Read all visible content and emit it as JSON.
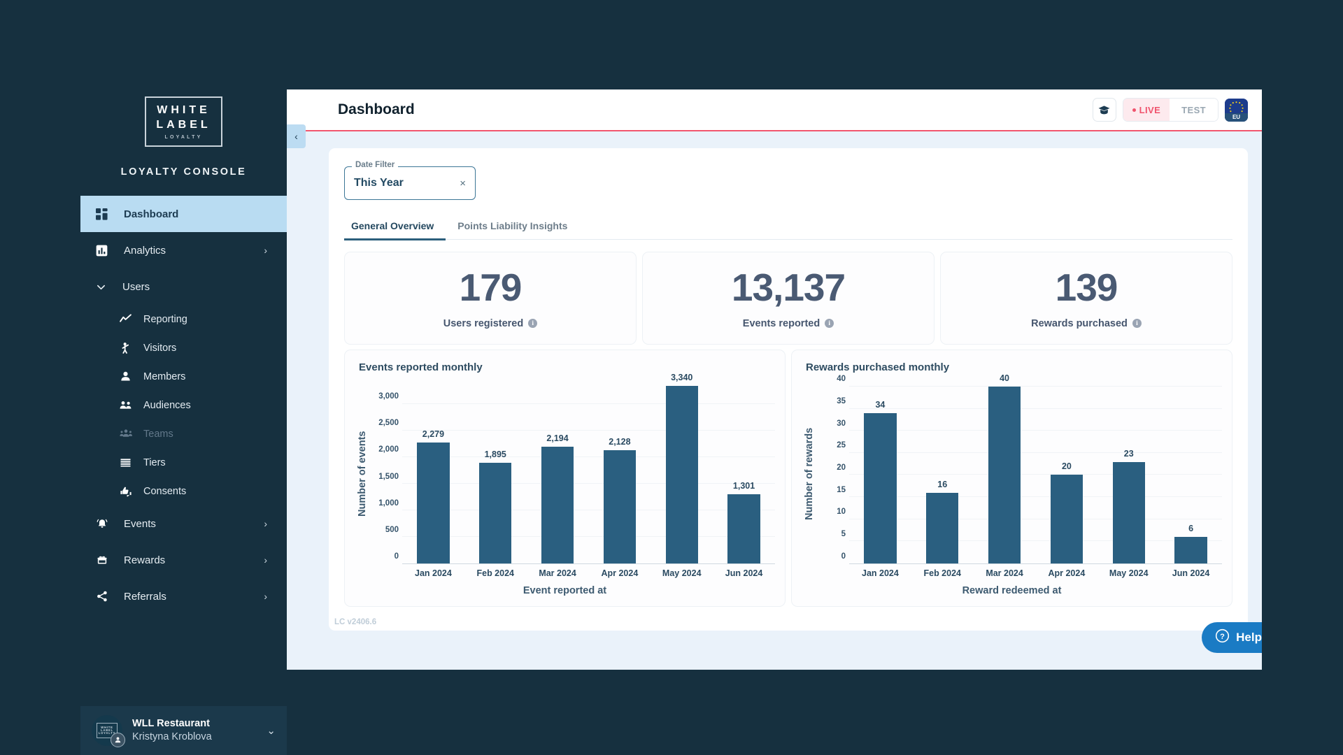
{
  "sidebar": {
    "logo": {
      "line1": "WHITE",
      "line2": "LABEL",
      "line3": "LOYALTY"
    },
    "console_title": "LOYALTY CONSOLE",
    "items": [
      {
        "label": "Dashboard",
        "icon": "dashboard-grid-icon",
        "active": true
      },
      {
        "label": "Analytics",
        "icon": "bar-chart-icon",
        "chevron": "›"
      },
      {
        "label": "Users",
        "icon": "chevron-down-icon",
        "expanded": true
      },
      {
        "label": "Reporting",
        "icon": "line-chart-icon",
        "sub": true
      },
      {
        "label": "Visitors",
        "icon": "visitor-person-icon",
        "sub": true
      },
      {
        "label": "Members",
        "icon": "person-icon",
        "sub": true
      },
      {
        "label": "Audiences",
        "icon": "people-group-icon",
        "sub": true
      },
      {
        "label": "Teams",
        "icon": "teams-icon",
        "sub": true,
        "disabled": true
      },
      {
        "label": "Tiers",
        "icon": "layers-lines-icon",
        "sub": true
      },
      {
        "label": "Consents",
        "icon": "thumbs-up-down-icon",
        "sub": true
      },
      {
        "label": "Events",
        "icon": "bell-icon",
        "chevron": "›"
      },
      {
        "label": "Rewards",
        "icon": "gift-icon",
        "chevron": "›"
      },
      {
        "label": "Referrals",
        "icon": "share-icon",
        "chevron": "›"
      }
    ],
    "profile": {
      "org": "WLL Restaurant",
      "user": "Kristyna Kroblova",
      "chevron": "⌄"
    }
  },
  "collapse_handle": {
    "glyph": "‹"
  },
  "header": {
    "title": "Dashboard",
    "graduation_icon": "graduation-cap-icon",
    "env_live": "LIVE",
    "env_test": "TEST",
    "region_badge": "EU",
    "accent_color": "#f2566e"
  },
  "filters": {
    "date_filter_legend": "Date Filter",
    "date_filter_value": "This Year",
    "clear_glyph": "×"
  },
  "tabs": [
    {
      "label": "General Overview",
      "active": true
    },
    {
      "label": "Points Liability Insights",
      "active": false
    }
  ],
  "kpis": [
    {
      "value": "179",
      "label": "Users registered",
      "info": "i"
    },
    {
      "value": "13,137",
      "label": "Events reported",
      "info": "i"
    },
    {
      "value": "139",
      "label": "Rewards purchased",
      "info": "i"
    }
  ],
  "footer": {
    "version": "LC v2406.6",
    "help_label": "Help",
    "help_icon": "question-circle-icon"
  },
  "chart_data": [
    {
      "type": "bar",
      "title": "Events reported monthly",
      "xlabel": "Event reported at",
      "ylabel": "Number of events",
      "categories": [
        "Jan 2024",
        "Feb 2024",
        "Mar 2024",
        "Apr 2024",
        "May 2024",
        "Jun 2024"
      ],
      "values": [
        2279,
        1895,
        2194,
        2128,
        3340,
        1301
      ],
      "value_labels": [
        "2,279",
        "1,895",
        "2,194",
        "2,128",
        "3,340",
        "1,301"
      ],
      "yticks": [
        0,
        500,
        1000,
        1500,
        2000,
        2500,
        3000
      ],
      "ytick_labels": [
        "0",
        "500",
        "1,000",
        "1,500",
        "2,000",
        "2,500",
        "3,000"
      ],
      "ylim": [
        0,
        3480
      ],
      "grid": true,
      "bar_color": "#2a5f80"
    },
    {
      "type": "bar",
      "title": "Rewards purchased monthly",
      "xlabel": "Reward redeemed at",
      "ylabel": "Number of rewards",
      "categories": [
        "Jan 2024",
        "Feb 2024",
        "Mar 2024",
        "Apr 2024",
        "May 2024",
        "Jun 2024"
      ],
      "values": [
        34,
        16,
        40,
        20,
        23,
        6
      ],
      "value_labels": [
        "34",
        "16",
        "40",
        "20",
        "23",
        "6"
      ],
      "yticks": [
        0,
        5,
        10,
        15,
        20,
        25,
        30,
        35,
        40
      ],
      "ytick_labels": [
        "0",
        "5",
        "10",
        "15",
        "20",
        "25",
        "30",
        "35",
        "40"
      ],
      "ylim": [
        0,
        41.8
      ],
      "grid": true,
      "bar_color": "#2a5f80"
    }
  ]
}
